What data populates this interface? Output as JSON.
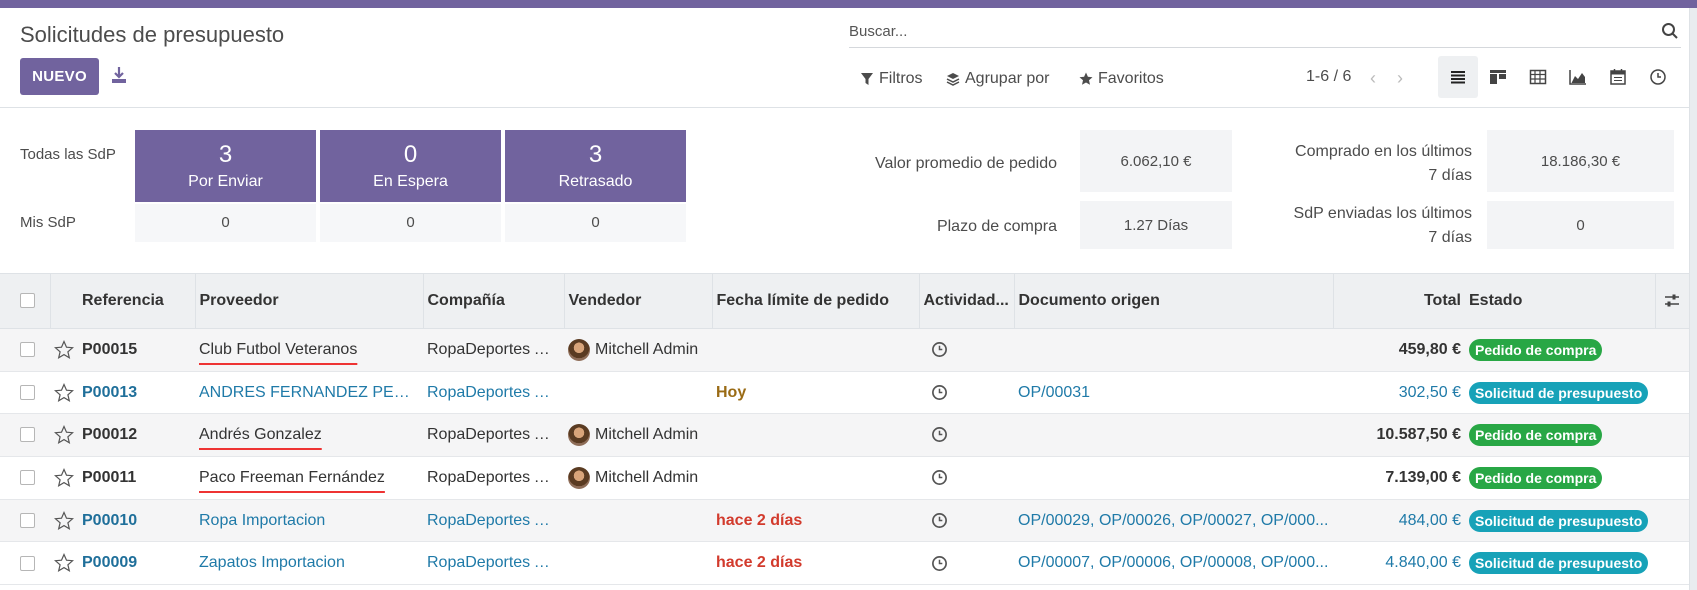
{
  "header": {
    "title": "Solicitudes de presupuesto",
    "new_label": "NUEVO",
    "search_placeholder": "Buscar...",
    "filters_label": "Filtros",
    "groupby_label": "Agrupar por",
    "favorites_label": "Favoritos",
    "pager": "1-6 / 6"
  },
  "dashboard": {
    "all_label": "Todas las SdP",
    "mine_label": "Mis SdP",
    "tiles": [
      {
        "count": "3",
        "label": "Por Enviar",
        "mine": "0"
      },
      {
        "count": "0",
        "label": "En Espera",
        "mine": "0"
      },
      {
        "count": "3",
        "label": "Retrasado",
        "mine": "0"
      }
    ],
    "stats": {
      "avg_label": "Valor promedio de pedido",
      "avg_value": "6.062,10 €",
      "lead_label": "Plazo de compra",
      "lead_value": "1.27 Días",
      "bought_label_1": "Comprado en los últimos",
      "bought_label_2": "7 días",
      "bought_value": "18.186,30 €",
      "sent_label_1": "SdP enviadas los últimos",
      "sent_label_2": "7 días",
      "sent_value": "0"
    }
  },
  "table": {
    "columns": {
      "ref": "Referencia",
      "vendor": "Proveedor",
      "company": "Compañía",
      "buyer": "Vendedor",
      "deadline": "Fecha límite de pedido",
      "activity": "Actividad...",
      "origin": "Documento origen",
      "total": "Total",
      "state": "Estado"
    },
    "rows": [
      {
        "ref": "P00015",
        "vendor": "Club Futbol Veteranos",
        "company": "RopaDeportes A.D",
        "buyer": "Mitchell Admin",
        "deadline": "",
        "origin": "",
        "total": "459,80 €",
        "state": "Pedido de compra"
      },
      {
        "ref": "P00013",
        "vendor": "ANDRES FERNANDEZ PEREIRA",
        "company": "RopaDeportes A.D",
        "buyer": "",
        "deadline": "Hoy",
        "origin": "OP/00031",
        "total": "302,50 €",
        "state": "Solicitud de presupuesto"
      },
      {
        "ref": "P00012",
        "vendor": "Andrés Gonzalez",
        "company": "RopaDeportes A.D",
        "buyer": "Mitchell Admin",
        "deadline": "",
        "origin": "",
        "total": "10.587,50 €",
        "state": "Pedido de compra"
      },
      {
        "ref": "P00011",
        "vendor": "Paco Freeman Fernández",
        "company": "RopaDeportes A.D",
        "buyer": "Mitchell Admin",
        "deadline": "",
        "origin": "",
        "total": "7.139,00 €",
        "state": "Pedido de compra"
      },
      {
        "ref": "P00010",
        "vendor": "Ropa Importacion",
        "company": "RopaDeportes A.D",
        "buyer": "",
        "deadline": "hace 2 días",
        "origin": "OP/00029, OP/00026, OP/00027, OP/000...",
        "total": "484,00 €",
        "state": "Solicitud de presupuesto"
      },
      {
        "ref": "P00009",
        "vendor": "Zapatos Importacion",
        "company": "RopaDeportes A.D",
        "buyer": "",
        "deadline": "hace 2 días",
        "origin": "OP/00007, OP/00006, OP/00008, OP/000...",
        "total": "4.840,00 €",
        "state": "Solicitud de presupuesto"
      }
    ]
  },
  "colors": {
    "brand": "#71639e",
    "badge_green": "#28a745",
    "badge_blue": "#17a2b8",
    "late": "#d23a2c",
    "today": "#9a6b15"
  }
}
